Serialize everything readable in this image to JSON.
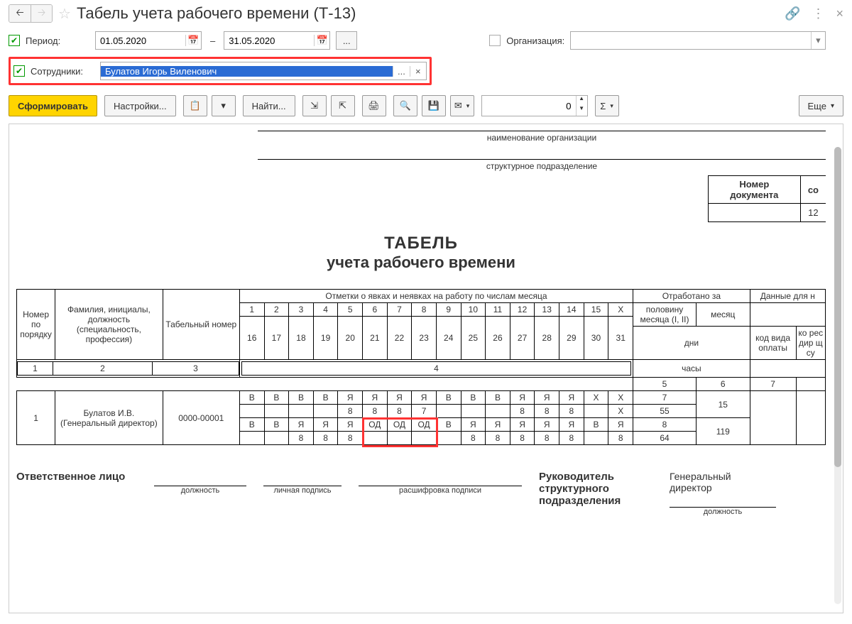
{
  "header": {
    "title": "Табель учета рабочего времени (Т-13)"
  },
  "filters": {
    "period_label": "Период:",
    "date_from": "01.05.2020",
    "date_to": "31.05.2020",
    "dash": "–",
    "ellipsis": "...",
    "org_label": "Организация:",
    "org_value": "",
    "emp_label": "Сотрудники:",
    "emp_value": "Булатов Игорь Виленович"
  },
  "toolbar": {
    "generate": "Сформировать",
    "settings": "Настройки...",
    "find": "Найти...",
    "spin_value": "0",
    "more": "Еще"
  },
  "report": {
    "org_caption": "наименование организации",
    "dep_caption": "структурное подразделение",
    "docnum_h": "Номер документа",
    "docnum_h2": "со",
    "docnum_v2": "12",
    "title1": "ТАБЕЛЬ",
    "title2": "учета  рабочего времени",
    "headers": {
      "npp": "Номер по порядку",
      "fio": "Фамилия, инициалы, должность (специальность, профессия)",
      "tabnum": "Табельный номер",
      "marks": "Отметки о явках и неявках на работу по числам месяца",
      "worked": "Отработано за",
      "half": "половину месяца (I, II)",
      "month": "месяц",
      "days": "дни",
      "hours": "часы",
      "data_for": "Данные для н",
      "paycode": "код вида оплаты",
      "corresp": "ко рес дир щ су"
    },
    "colnums": {
      "c1": "1",
      "c2": "2",
      "c3": "3",
      "c4": "4",
      "c5": "5",
      "c6": "6",
      "c7": "7"
    },
    "days_row1": [
      "1",
      "2",
      "3",
      "4",
      "5",
      "6",
      "7",
      "8",
      "9",
      "10",
      "11",
      "12",
      "13",
      "14",
      "15",
      "Х"
    ],
    "days_row2": [
      "16",
      "17",
      "18",
      "19",
      "20",
      "21",
      "22",
      "23",
      "24",
      "25",
      "26",
      "27",
      "28",
      "29",
      "30",
      "31"
    ],
    "emp": {
      "num": "1",
      "name": "Булатов И.В. (Генеральный директор)",
      "tab": "0000-00001",
      "r1_codes": [
        "В",
        "В",
        "В",
        "В",
        "Я",
        "Я",
        "Я",
        "Я",
        "В",
        "В",
        "В",
        "Я",
        "Я",
        "Я",
        "Х"
      ],
      "r1_hours": [
        "",
        "",
        "",
        "",
        "8",
        "8",
        "8",
        "7",
        "",
        "",
        "",
        "8",
        "8",
        "8",
        ""
      ],
      "r2_codes": [
        "В",
        "В",
        "Я",
        "Я",
        "Я",
        "ОД",
        "ОД",
        "ОД",
        "В",
        "Я",
        "Я",
        "Я",
        "Я",
        "Я",
        "В",
        "Я"
      ],
      "r2_hours": [
        "",
        "",
        "8",
        "8",
        "8",
        "",
        "",
        "",
        "",
        "8",
        "8",
        "8",
        "8",
        "8",
        "",
        "8"
      ],
      "half1_days": "7",
      "half1_hours": "55",
      "half2_days": "8",
      "half2_hours": "64",
      "month_days": "15",
      "month_hours": "119"
    },
    "sign": {
      "resp": "Ответственное лицо",
      "pos": "должность",
      "sig": "личная подпись",
      "decode": "расшифровка подписи",
      "head": "Руководитель структурного подразделения",
      "head_pos": "Генеральный директор",
      "pos2": "должность"
    }
  }
}
